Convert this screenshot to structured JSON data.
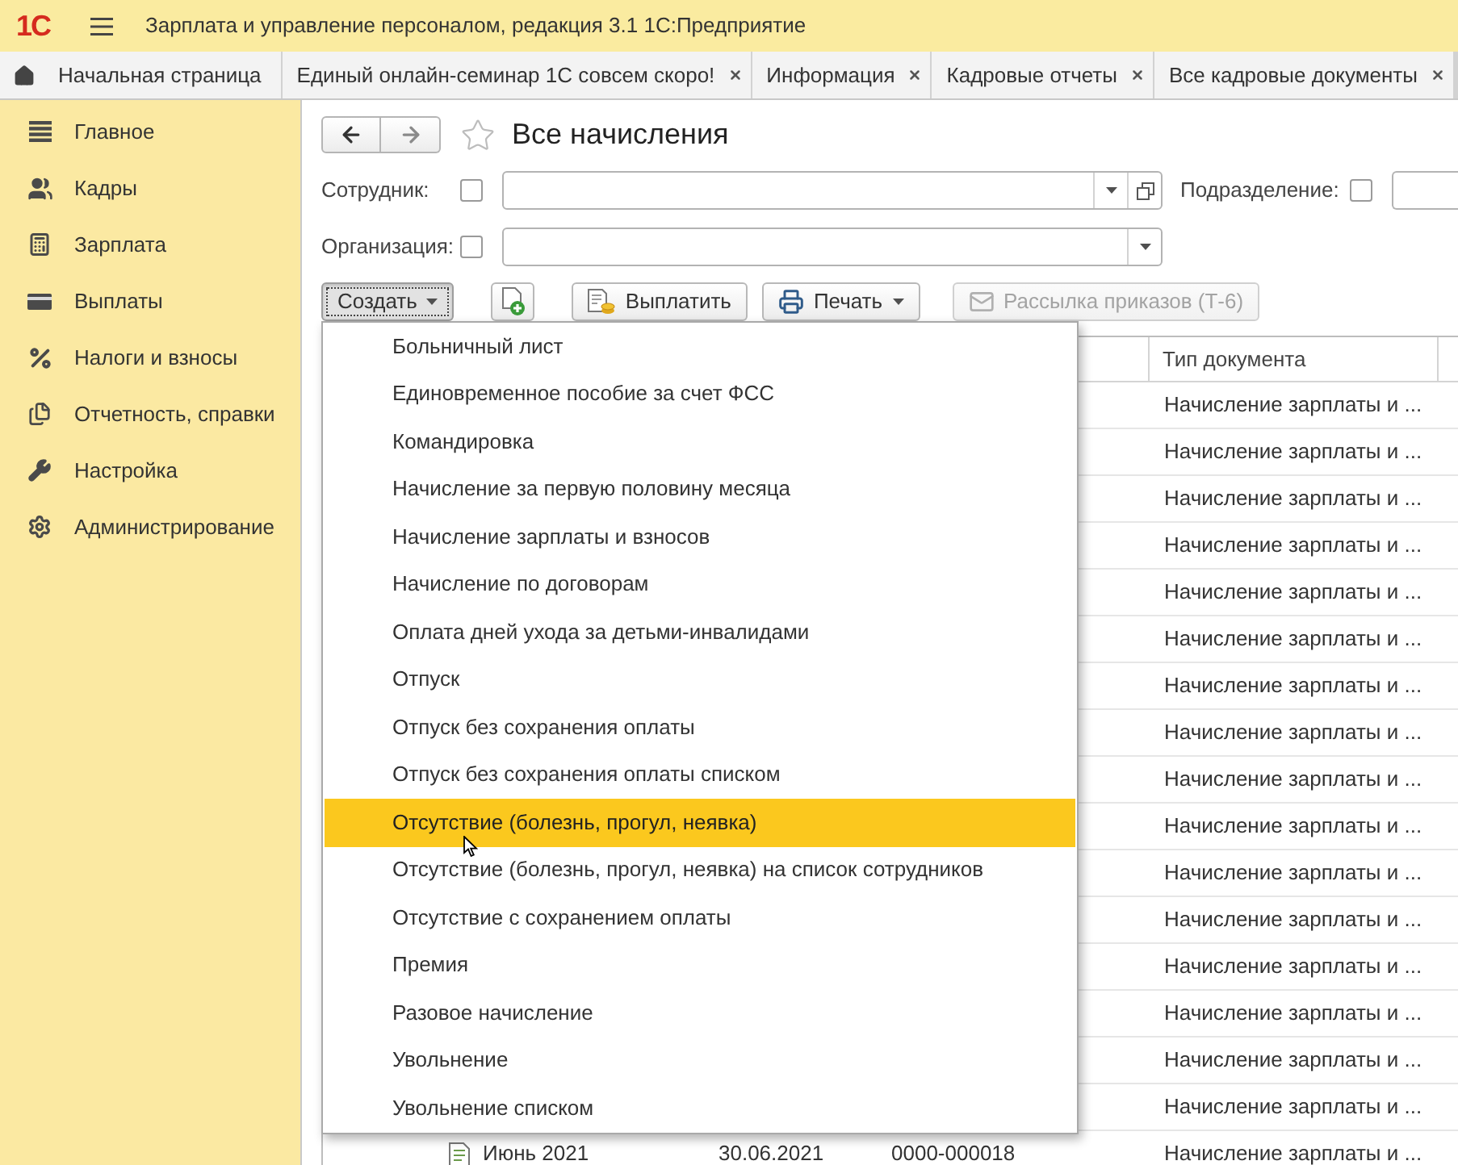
{
  "app": {
    "logo": "1С",
    "title": "Зарплата и управление персоналом, редакция 3.1 1С:Предприятие"
  },
  "tabs": [
    {
      "label": "Начальная страница",
      "kind": "home",
      "selected": false
    },
    {
      "label": "Единый онлайн-семинар 1С совсем скоро!",
      "kind": "closable",
      "selected": false
    },
    {
      "label": "Информация",
      "kind": "closable",
      "selected": false
    },
    {
      "label": "Кадровые отчеты",
      "kind": "closable",
      "selected": false
    },
    {
      "label": "Все кадровые документы",
      "kind": "closable",
      "selected": false
    }
  ],
  "sidebar": {
    "items": [
      {
        "label": "Главное"
      },
      {
        "label": "Кадры"
      },
      {
        "label": "Зарплата"
      },
      {
        "label": "Выплаты"
      },
      {
        "label": "Налоги и взносы"
      },
      {
        "label": "Отчетность, справки"
      },
      {
        "label": "Настройка"
      },
      {
        "label": "Администрирование"
      }
    ]
  },
  "form": {
    "title": "Все начисления",
    "favorite": false,
    "filter_rows": [
      {
        "fields": [
          {
            "label": "Сотрудник:",
            "checked": false,
            "kind": "select_open"
          },
          {
            "label": "Подразделение:",
            "checked": false,
            "kind": "plain"
          }
        ]
      },
      {
        "fields": [
          {
            "label": "Организация:",
            "checked": false,
            "kind": "select"
          }
        ]
      }
    ],
    "toolbar": [
      {
        "label": "Создать",
        "kind": "menu",
        "pressed": true,
        "disabled": false
      },
      {
        "kind": "icon",
        "pressed": false,
        "disabled": false
      },
      {
        "label": "Выплатить",
        "kind": "plain",
        "pressed": false,
        "disabled": false
      },
      {
        "label": "Печать",
        "kind": "menu",
        "pressed": false,
        "disabled": false
      },
      {
        "label": "Рассылка приказов (Т-6)",
        "kind": "plain",
        "pressed": false,
        "disabled": true
      }
    ]
  },
  "create_menu": {
    "items": [
      {
        "label": "Больничный лист",
        "selected": false
      },
      {
        "label": "Единовременное пособие за счет ФСС",
        "selected": false
      },
      {
        "label": "Командировка",
        "selected": false
      },
      {
        "label": "Начисление за первую половину месяца",
        "selected": false
      },
      {
        "label": "Начисление зарплаты и взносов",
        "selected": false
      },
      {
        "label": "Начисление по договорам",
        "selected": false
      },
      {
        "label": "Оплата дней ухода за детьми-инвалидами",
        "selected": false
      },
      {
        "label": "Отпуск",
        "selected": false
      },
      {
        "label": "Отпуск без сохранения оплаты",
        "selected": false
      },
      {
        "label": "Отпуск без сохранения оплаты списком",
        "selected": false
      },
      {
        "label": "Отсутствие (болезнь, прогул, неявка)",
        "selected": true
      },
      {
        "label": "Отсутствие (болезнь, прогул, неявка) на список сотрудников",
        "selected": false
      },
      {
        "label": "Отсутствие с сохранением оплаты",
        "selected": false
      },
      {
        "label": "Премия",
        "selected": false
      },
      {
        "label": "Разовое начисление",
        "selected": false
      },
      {
        "label": "Увольнение",
        "selected": false
      },
      {
        "label": "Увольнение списком",
        "selected": false
      }
    ]
  },
  "table": {
    "document_type_header": "Тип документа",
    "rows": [
      {
        "document_type": "Начисление зарплаты и ..."
      },
      {
        "document_type": "Начисление зарплаты и ..."
      },
      {
        "document_type": "Начисление зарплаты и ..."
      },
      {
        "document_type": "Начисление зарплаты и ..."
      },
      {
        "document_type": "Начисление зарплаты и ..."
      },
      {
        "document_type": "Начисление зарплаты и ..."
      },
      {
        "document_type": "Начисление зарплаты и ..."
      },
      {
        "document_type": "Начисление зарплаты и ..."
      },
      {
        "document_type": "Начисление зарплаты и ..."
      },
      {
        "document_type": "Начисление зарплаты и ..."
      },
      {
        "document_type": "Начисление зарплаты и ..."
      },
      {
        "document_type": "Начисление зарплаты и ..."
      },
      {
        "document_type": "Начисление зарплаты и ..."
      },
      {
        "document_type": "Начисление зарплаты и ..."
      },
      {
        "document_type": "Начисление зарплаты и ..."
      },
      {
        "document_type": "Начисление зарплаты и ..."
      },
      {
        "column_1": "Июнь 2021",
        "column_2": "30.06.2021",
        "column_3": "0000-000018",
        "document_type": "Начисление зарплаты и ..."
      }
    ]
  }
}
